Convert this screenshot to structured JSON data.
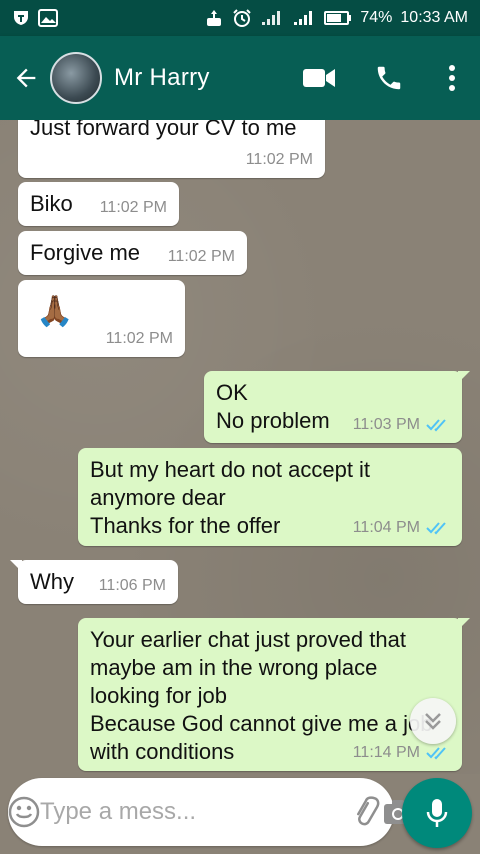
{
  "status_bar": {
    "battery": "74%",
    "time": "10:33 AM"
  },
  "header": {
    "contact_name": "Mr Harry"
  },
  "messages": [
    {
      "dir": "in",
      "text": "Just forward your CV to me",
      "time": "11:02 PM"
    },
    {
      "dir": "in",
      "text": "Biko",
      "time": "11:02 PM"
    },
    {
      "dir": "in",
      "text": "Forgive me",
      "time": "11:02 PM"
    },
    {
      "dir": "in",
      "text": "🙏🏾",
      "time": "11:02 PM"
    },
    {
      "dir": "out",
      "text": "OK\nNo problem",
      "time": "11:03 PM",
      "read": true
    },
    {
      "dir": "out",
      "text": "But my heart do not accept it\nanymore dear\nThanks for the offer",
      "time": "11:04 PM",
      "read": true
    },
    {
      "dir": "in",
      "text": "Why",
      "time": "11:06 PM"
    },
    {
      "dir": "out",
      "text": "Your earlier chat just proved that\nmaybe am in the wrong place\nlooking for job\nBecause God cannot give me a job\nwith conditions",
      "time": "11:14 PM",
      "read": true
    }
  ],
  "composer": {
    "placeholder": "Type a mess..."
  },
  "colors": {
    "header": "#075e54",
    "status_bar": "#054d44",
    "incoming_bubble": "#ffffff",
    "outgoing_bubble": "#dcf8c6",
    "read_ticks": "#4fc3f7",
    "mic_button": "#00897b"
  },
  "icons": {
    "back": "arrow-left-icon",
    "video": "video-camera-icon",
    "call": "phone-icon",
    "more": "more-vertical-icon",
    "emoji": "emoji-icon",
    "attach": "paperclip-icon",
    "camera": "camera-icon",
    "mic": "microphone-icon",
    "scroll": "double-chevron-down-icon"
  }
}
